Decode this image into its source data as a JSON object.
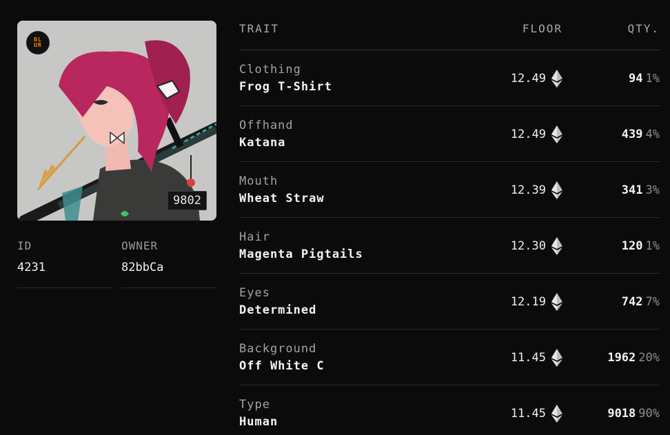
{
  "nft": {
    "logo_line1": "BL",
    "logo_line2": "UR",
    "rank": "9802",
    "id_label": "ID",
    "id_value": "4231",
    "owner_label": "OWNER",
    "owner_value": "82bbCa"
  },
  "table": {
    "header_trait": "TRAIT",
    "header_floor": "FLOOR",
    "header_qty": "QTY.",
    "rows": [
      {
        "category": "Clothing",
        "value": "Frog T-Shirt",
        "floor": "12.49",
        "qty": "94",
        "pct": "1%"
      },
      {
        "category": "Offhand",
        "value": "Katana",
        "floor": "12.49",
        "qty": "439",
        "pct": "4%"
      },
      {
        "category": "Mouth",
        "value": "Wheat Straw",
        "floor": "12.39",
        "qty": "341",
        "pct": "3%"
      },
      {
        "category": "Hair",
        "value": "Magenta Pigtails",
        "floor": "12.30",
        "qty": "120",
        "pct": "1%"
      },
      {
        "category": "Eyes",
        "value": "Determined",
        "floor": "12.19",
        "qty": "742",
        "pct": "7%"
      },
      {
        "category": "Background",
        "value": "Off White C",
        "floor": "11.45",
        "qty": "1962",
        "pct": "20%"
      },
      {
        "category": "Type",
        "value": "Human",
        "floor": "11.45",
        "qty": "9018",
        "pct": "90%"
      }
    ]
  },
  "colors": {
    "background": "#0b0b0b",
    "logo_accent": "#ff8a00",
    "hair": "#b8275e",
    "image_bg": "#c7c8c6"
  },
  "icons": {
    "currency": "ethereum-icon"
  }
}
